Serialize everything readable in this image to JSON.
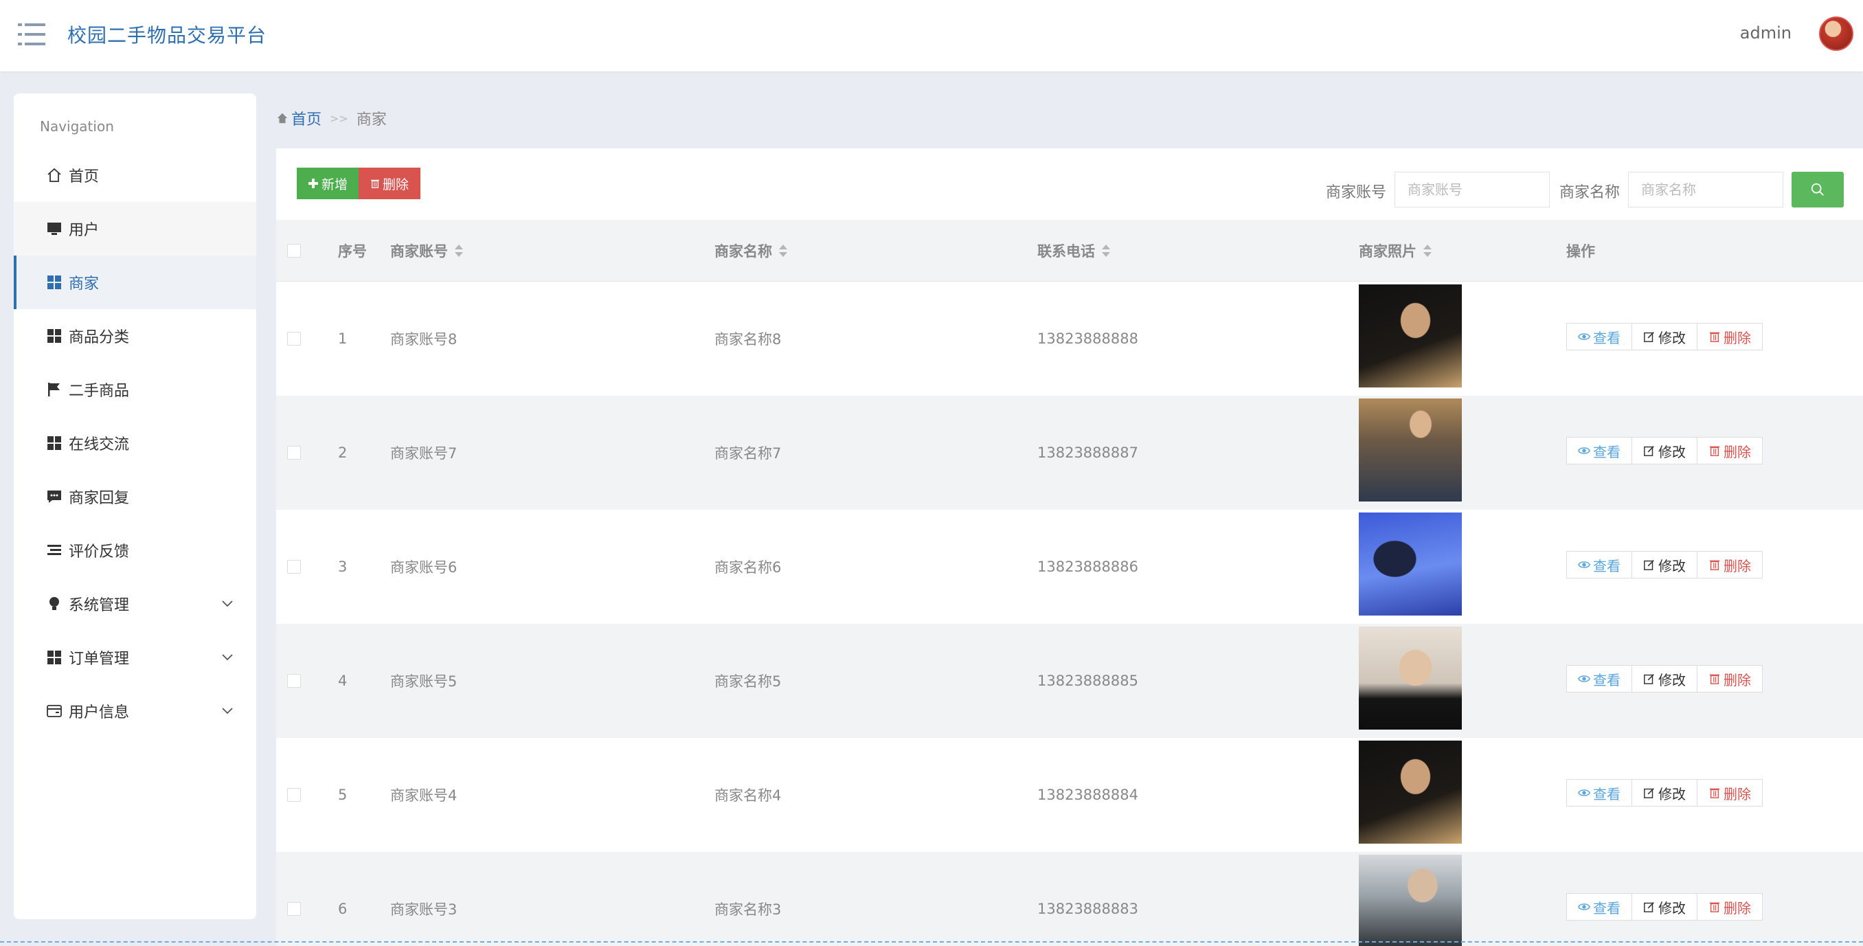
{
  "header": {
    "brand": "校园二手物品交易平台",
    "user": "admin"
  },
  "sidebar": {
    "title": "Navigation",
    "items": [
      {
        "label": "首页",
        "icon": "home-icon"
      },
      {
        "label": "用户",
        "icon": "monitor-icon"
      },
      {
        "label": "商家",
        "icon": "grid-icon",
        "active": true
      },
      {
        "label": "商品分类",
        "icon": "grid-icon"
      },
      {
        "label": "二手商品",
        "icon": "flag-icon"
      },
      {
        "label": "在线交流",
        "icon": "grid-icon"
      },
      {
        "label": "商家回复",
        "icon": "comment-icon"
      },
      {
        "label": "评价反馈",
        "icon": "list-icon"
      },
      {
        "label": "系统管理",
        "icon": "bulb-icon",
        "expandable": true
      },
      {
        "label": "订单管理",
        "icon": "grid-icon",
        "expandable": true
      },
      {
        "label": "用户信息",
        "icon": "card-icon",
        "expandable": true
      }
    ]
  },
  "breadcrumb": {
    "home": "首页",
    "separator": ">>",
    "current": "商家"
  },
  "toolbar": {
    "add_label": "新增",
    "delete_label": "删除",
    "account_label": "商家账号",
    "account_placeholder": "商家账号",
    "name_label": "商家名称",
    "name_placeholder": "商家名称"
  },
  "table": {
    "headers": {
      "index": "序号",
      "account": "商家账号",
      "name": "商家名称",
      "phone": "联系电话",
      "photo": "商家照片",
      "ops": "操作"
    },
    "ops": {
      "view": "查看",
      "edit": "修改",
      "delete": "删除"
    },
    "rows": [
      {
        "index": "1",
        "account": "商家账号8",
        "name": "商家名称8",
        "phone": "13823888888"
      },
      {
        "index": "2",
        "account": "商家账号7",
        "name": "商家名称7",
        "phone": "13823888887"
      },
      {
        "index": "3",
        "account": "商家账号6",
        "name": "商家名称6",
        "phone": "13823888886"
      },
      {
        "index": "4",
        "account": "商家账号5",
        "name": "商家名称5",
        "phone": "13823888885"
      },
      {
        "index": "5",
        "account": "商家账号4",
        "name": "商家名称4",
        "phone": "13823888884"
      },
      {
        "index": "6",
        "account": "商家账号3",
        "name": "商家名称3",
        "phone": "13823888883"
      }
    ]
  },
  "colors": {
    "brand": "#2f6fb0",
    "add": "#4cae4c",
    "danger": "#d9534f",
    "search": "#5cb85c",
    "view": "#5aa6dd"
  }
}
